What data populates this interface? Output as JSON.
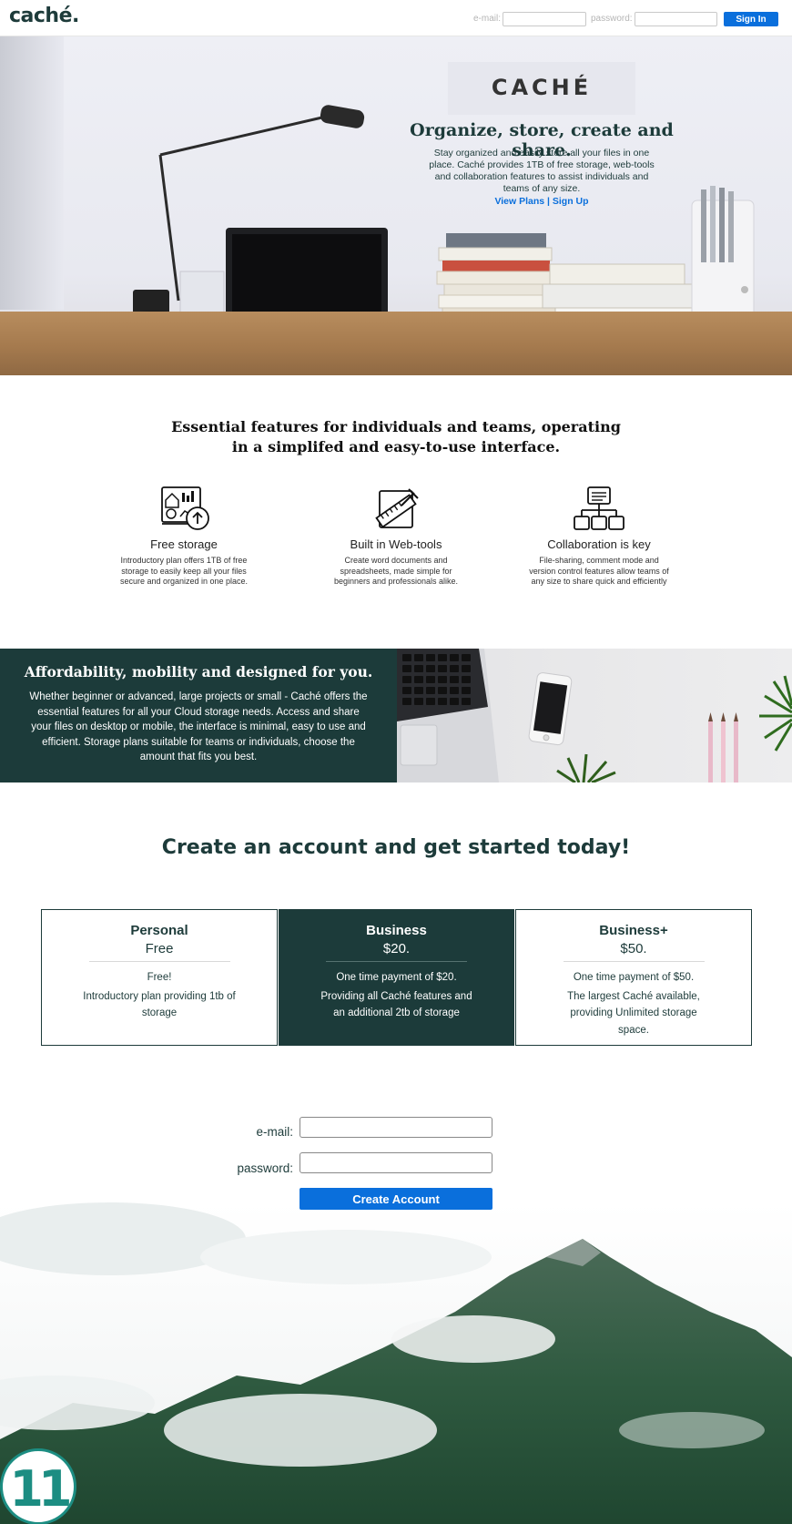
{
  "nav": {
    "logo": "caché.",
    "email_label": "e-mail:",
    "password_label": "password:",
    "email_value": "",
    "password_value": "",
    "signin_label": "Sign In"
  },
  "hero": {
    "brand": "CACHÉ",
    "title": "Organize, store, create and share.",
    "text": "Stay organized and easily store all your files in one place. Caché provides 1TB of free storage, web-tools and collaboration features to assist individuals and teams of any size.",
    "link_plans": "View Plans",
    "link_separator": " | ",
    "link_signup": "Sign Up"
  },
  "features": {
    "heading": "Essential features for individuals and teams, operating in a simplifed and easy-to-use interface.",
    "items": [
      {
        "icon": "storage-upload-icon",
        "title": "Free storage",
        "text": "Introductory plan offers 1TB of free storage to easily keep all your files secure and organized in one place."
      },
      {
        "icon": "ruler-pencil-icon",
        "title": "Built in Web-tools",
        "text": "Create word documents and spreadsheets, made simple for beginners and professionals alike."
      },
      {
        "icon": "hierarchy-icon",
        "title": "Collaboration is key",
        "text": "File-sharing, comment mode and version control features allow teams of any size to share quick and efficiently"
      }
    ]
  },
  "afford": {
    "title": "Affordability, mobility and designed for you.",
    "text": "Whether beginner or advanced, large projects or small - Caché offers the essential features for all your Cloud storage needs. Access and share your files on desktop or mobile, the interface is minimal, easy to use and efficient. Storage plans suitable for teams or individuals, choose the amount that fits you best."
  },
  "cta": {
    "title": "Create an account and get started today!"
  },
  "plans": [
    {
      "name": "Personal",
      "price": "Free",
      "line1": "Free!",
      "line2": "Introductory plan providing 1tb of storage"
    },
    {
      "name": "Business",
      "price": "$20.",
      "line1": "One time payment of $20.",
      "line2": "Providing all Caché features and an additional 2tb of storage"
    },
    {
      "name": "Business+",
      "price": "$50.",
      "line1": "One time payment of $50.",
      "line2": "The largest Caché available, providing Unlimited storage space."
    }
  ],
  "signup": {
    "email_label": "e-mail:",
    "password_label": "password:",
    "email_value": "",
    "password_value": "",
    "button_label": "Create Account"
  },
  "badge": {
    "number": "11"
  },
  "colors": {
    "brand_dark": "#1c3b3a",
    "accent_blue": "#0a6fdc",
    "badge_teal": "#1c8d82"
  }
}
